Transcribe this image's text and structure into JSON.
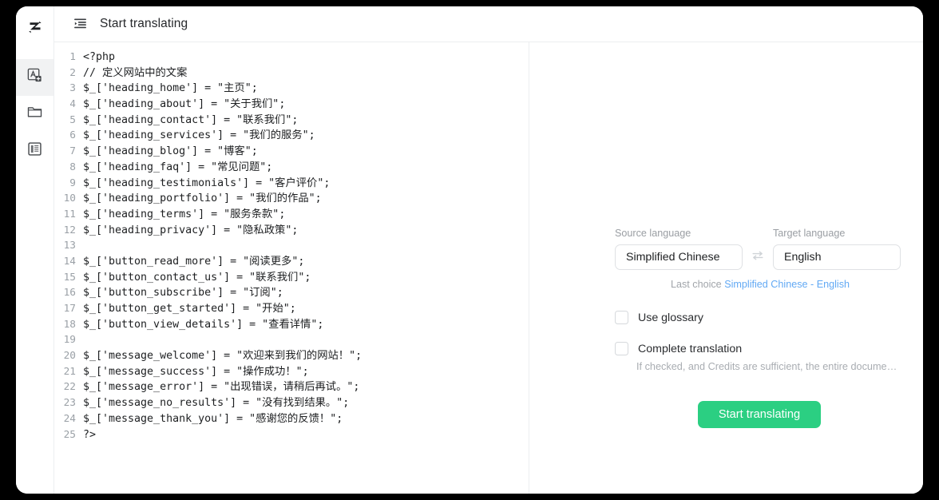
{
  "window": {
    "logo_icon": "zaku-logo-icon"
  },
  "rail": {
    "items": [
      {
        "icon": "add-translate-document-icon",
        "name": "rail-item-new-translation",
        "active": true
      },
      {
        "icon": "folder-icon",
        "name": "rail-item-files",
        "active": false
      },
      {
        "icon": "document-list-icon",
        "name": "rail-item-records",
        "active": false
      }
    ]
  },
  "titlebar": {
    "icon": "list-indent-icon",
    "title": "Start translating"
  },
  "editor": {
    "lines": [
      {
        "n": "1",
        "text": "<?php"
      },
      {
        "n": "2",
        "text": "// 定义网站中的文案"
      },
      {
        "n": "3",
        "text": "$_['heading_home'] = \"主页\";"
      },
      {
        "n": "4",
        "text": "$_['heading_about'] = \"关于我们\";"
      },
      {
        "n": "5",
        "text": "$_['heading_contact'] = \"联系我们\";"
      },
      {
        "n": "6",
        "text": "$_['heading_services'] = \"我们的服务\";"
      },
      {
        "n": "7",
        "text": "$_['heading_blog'] = \"博客\";"
      },
      {
        "n": "8",
        "text": "$_['heading_faq'] = \"常见问题\";"
      },
      {
        "n": "9",
        "text": "$_['heading_testimonials'] = \"客户评价\";"
      },
      {
        "n": "10",
        "text": "$_['heading_portfolio'] = \"我们的作品\";"
      },
      {
        "n": "11",
        "text": "$_['heading_terms'] = \"服务条款\";"
      },
      {
        "n": "12",
        "text": "$_['heading_privacy'] = \"隐私政策\";"
      },
      {
        "n": "13",
        "text": ""
      },
      {
        "n": "14",
        "text": "$_['button_read_more'] = \"阅读更多\";"
      },
      {
        "n": "15",
        "text": "$_['button_contact_us'] = \"联系我们\";"
      },
      {
        "n": "16",
        "text": "$_['button_subscribe'] = \"订阅\";"
      },
      {
        "n": "17",
        "text": "$_['button_get_started'] = \"开始\";"
      },
      {
        "n": "18",
        "text": "$_['button_view_details'] = \"查看详情\";"
      },
      {
        "n": "19",
        "text": ""
      },
      {
        "n": "20",
        "text": "$_['message_welcome'] = \"欢迎来到我们的网站！\";"
      },
      {
        "n": "21",
        "text": "$_['message_success'] = \"操作成功！\";"
      },
      {
        "n": "22",
        "text": "$_['message_error'] = \"出现错误，请稍后再试。\";"
      },
      {
        "n": "23",
        "text": "$_['message_no_results'] = \"没有找到结果。\";"
      },
      {
        "n": "24",
        "text": "$_['message_thank_you'] = \"感谢您的反馈！\";"
      },
      {
        "n": "25",
        "text": "?>"
      }
    ]
  },
  "panel": {
    "source_label": "Source language",
    "target_label": "Target language",
    "source_value": "Simplified Chinese",
    "target_value": "English",
    "swap_icon": "swap-arrows-icon",
    "last_choice_label": "Last choice",
    "last_choice_value": "Simplified Chinese - English",
    "glossary_label": "Use glossary",
    "glossary_checked": false,
    "complete_label": "Complete translation",
    "complete_checked": false,
    "complete_hint": "If checked, and Credits are sufficient, the entire docume…",
    "submit_label": "Start translating"
  },
  "colors": {
    "accent_green": "#2bcf82",
    "link_blue": "#62a9f4",
    "muted_gray": "#9a9ea3",
    "border": "#eceef0"
  }
}
